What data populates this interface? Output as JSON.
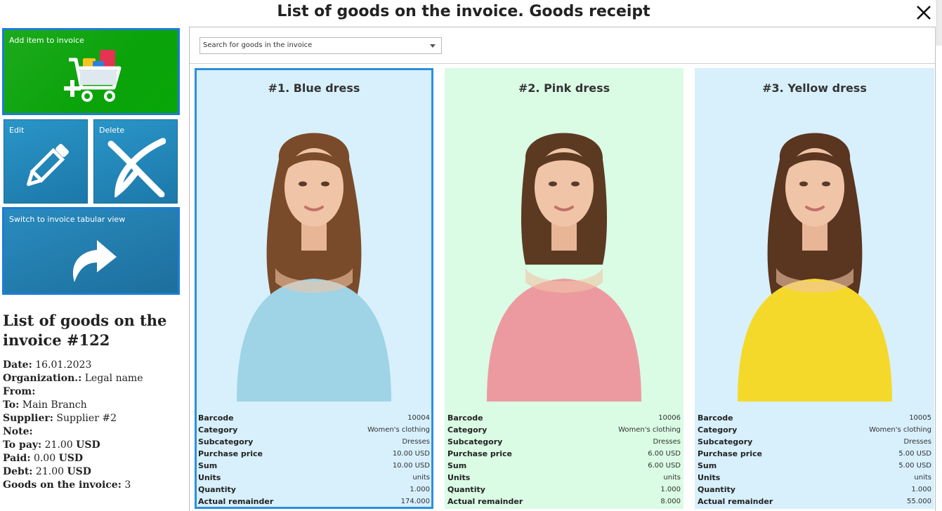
{
  "window": {
    "title": "List of goods on the invoice. Goods receipt"
  },
  "actions": {
    "add_label": "Add item to invoice",
    "edit_label": "Edit",
    "delete_label": "Delete",
    "switch_label": "Switch to invoice tabular view"
  },
  "summary": {
    "heading": "List of goods on the invoice #122",
    "rows": [
      {
        "label": "Date:",
        "value": " 16.01.2023",
        "unit": ""
      },
      {
        "label": "Organization.:",
        "value": " Legal name",
        "unit": ""
      },
      {
        "label": "From:",
        "value": "",
        "unit": ""
      },
      {
        "label": "To:",
        "value": " Main Branch",
        "unit": ""
      },
      {
        "label": "Supplier:",
        "value": " Supplier #2",
        "unit": ""
      },
      {
        "label": "Note:",
        "value": "",
        "unit": ""
      },
      {
        "label": "To pay:",
        "value": " 21.00 ",
        "unit": "USD"
      },
      {
        "label": "Paid:",
        "value": " 0.00 ",
        "unit": "USD"
      },
      {
        "label": "Debt:",
        "value": " 21.00 ",
        "unit": "USD"
      },
      {
        "label": "Goods on the invoice:",
        "value": " 3",
        "unit": ""
      }
    ]
  },
  "search": {
    "placeholder": "Search for goods in the invoice"
  },
  "products": [
    {
      "title": "#1. Blue dress",
      "background": "#d7f0fc",
      "dress_color": "#9fd3e6",
      "hair_color": "#7a4b2a",
      "selected": true,
      "attrs": [
        {
          "key": "Barcode",
          "value": "10004"
        },
        {
          "key": "Category",
          "value": "Women's clothing"
        },
        {
          "key": "Subcategory",
          "value": "Dresses"
        },
        {
          "key": "Purchase price",
          "value": "10.00 USD"
        },
        {
          "key": "Sum",
          "value": "10.00 USD"
        },
        {
          "key": "Units",
          "value": "units"
        },
        {
          "key": "Quantity",
          "value": "1.000"
        },
        {
          "key": "Actual remainder",
          "value": "174.000"
        }
      ]
    },
    {
      "title": "#2. Pink dress",
      "background": "#dafbe4",
      "dress_color": "#ec9aa0",
      "hair_color": "#5c3a22",
      "selected": false,
      "attrs": [
        {
          "key": "Barcode",
          "value": "10006"
        },
        {
          "key": "Category",
          "value": "Women's clothing"
        },
        {
          "key": "Subcategory",
          "value": "Dresses"
        },
        {
          "key": "Purchase price",
          "value": "6.00 USD"
        },
        {
          "key": "Sum",
          "value": "6.00 USD"
        },
        {
          "key": "Units",
          "value": "units"
        },
        {
          "key": "Quantity",
          "value": "1.000"
        },
        {
          "key": "Actual remainder",
          "value": "8.000"
        }
      ]
    },
    {
      "title": "#3. Yellow dress",
      "background": "#d7f0fc",
      "dress_color": "#f5d92a",
      "hair_color": "#5a3520",
      "selected": false,
      "attrs": [
        {
          "key": "Barcode",
          "value": "10005"
        },
        {
          "key": "Category",
          "value": "Women's clothing"
        },
        {
          "key": "Subcategory",
          "value": "Dresses"
        },
        {
          "key": "Purchase price",
          "value": "5.00 USD"
        },
        {
          "key": "Sum",
          "value": "5.00 USD"
        },
        {
          "key": "Units",
          "value": "units"
        },
        {
          "key": "Quantity",
          "value": "1.000"
        },
        {
          "key": "Actual remainder",
          "value": "55.000"
        }
      ]
    }
  ]
}
